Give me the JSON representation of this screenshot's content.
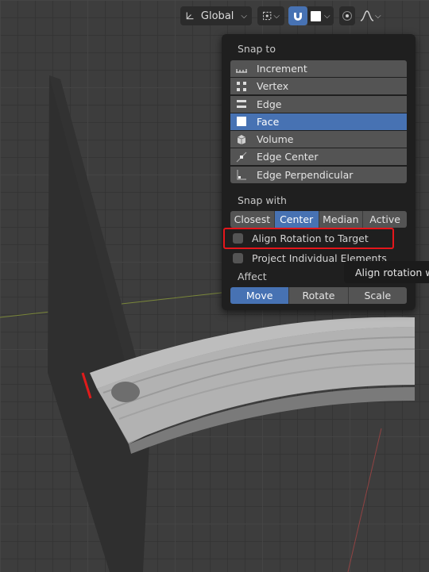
{
  "header": {
    "transform_orientation": "Global",
    "pivot_icon": "pivot-point-icon",
    "snap_icon": "magnet-snap-icon",
    "snap_target_icon": "face-square-icon",
    "proportional_icon": "proportional-editing-icon",
    "falloff_icon": "falloff-curve-icon"
  },
  "popup": {
    "snap_to_label": "Snap to",
    "snap_to_items": [
      {
        "label": "Increment",
        "icon": "increment-icon"
      },
      {
        "label": "Vertex",
        "icon": "vertex-icon"
      },
      {
        "label": "Edge",
        "icon": "edge-icon"
      },
      {
        "label": "Face",
        "icon": "face-icon"
      },
      {
        "label": "Volume",
        "icon": "volume-icon"
      },
      {
        "label": "Edge Center",
        "icon": "edge-center-icon"
      },
      {
        "label": "Edge Perpendicular",
        "icon": "edge-perpendicular-icon"
      }
    ],
    "snap_to_selected": "Face",
    "snap_with_label": "Snap with",
    "snap_with_options": [
      "Closest",
      "Center",
      "Median",
      "Active"
    ],
    "snap_with_selected": "Center",
    "align_rotation_label": "Align Rotation to Target",
    "project_individual_label": "Project Individual Elements",
    "affect_label": "Affect",
    "affect_options": [
      "Move",
      "Rotate",
      "Scale"
    ],
    "affect_selected": "Move"
  },
  "tooltip": {
    "text": "Align rotation wi"
  },
  "colors": {
    "accent": "#4772b3",
    "highlight_box": "#e5161b",
    "popup_bg": "#1f1f1f",
    "button_bg": "#545454"
  }
}
